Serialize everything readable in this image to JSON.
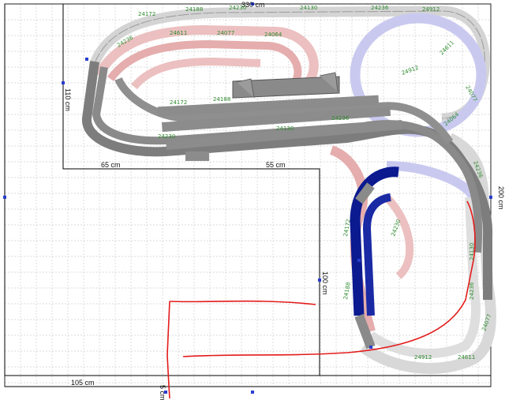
{
  "app": {
    "view": "track-plan-canvas"
  },
  "dimensions": {
    "top_width": "330 cm",
    "left_height": "110 cm",
    "left_bottom": "65 cm",
    "middle_bottom": "55 cm",
    "right_height": "200 cm",
    "inner_height": "100 cm",
    "bottom_width": "105 cm",
    "bottom_small": "5 cm"
  },
  "piece_codes": [
    "24172",
    "24188",
    "24230",
    "24130",
    "24236",
    "24912",
    "24611",
    "24077",
    "24064",
    "24236"
  ],
  "colors": {
    "grid": "#cfcfcf",
    "frame": "#000000",
    "track_gray": "#7f7f7f",
    "track_pink": "#e8b5b5",
    "track_light": "#dcdcdc",
    "track_blue_light": "#c7c7ee",
    "track_blue_dark": "#0a1a8c",
    "label_green": "#2e8b2e",
    "sketch_red": "#e41b1b"
  }
}
